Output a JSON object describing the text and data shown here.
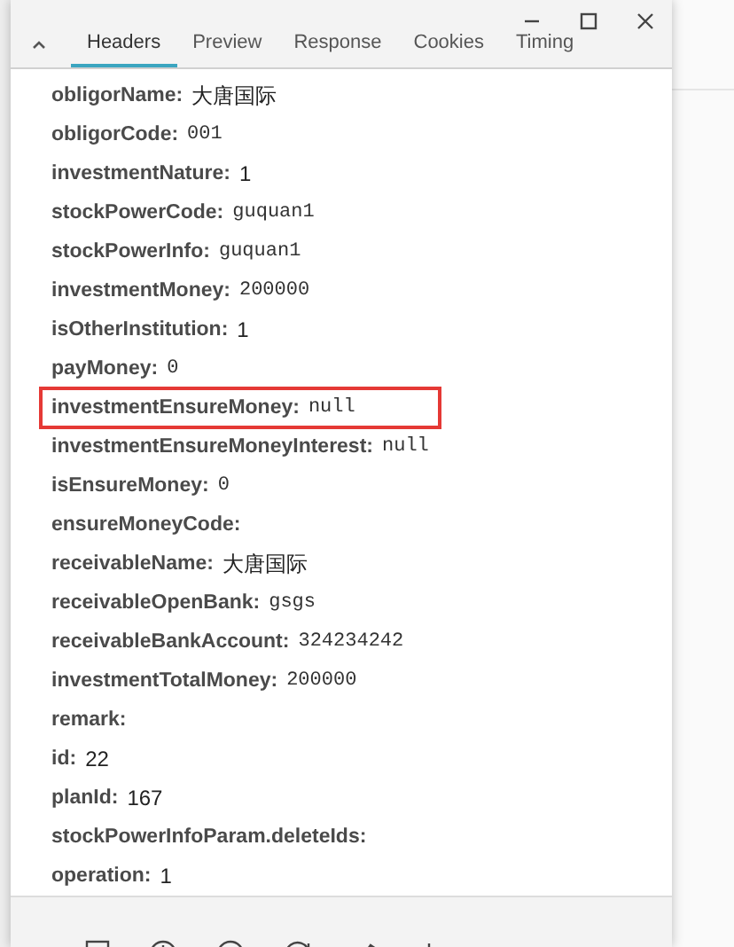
{
  "window": {
    "controls": [
      {
        "kind": "minimize"
      },
      {
        "kind": "maximize"
      },
      {
        "kind": "close"
      }
    ]
  },
  "tabs": [
    {
      "label": "Headers",
      "selected": true
    },
    {
      "label": "Preview",
      "selected": false
    },
    {
      "label": "Response",
      "selected": false
    },
    {
      "label": "Cookies",
      "selected": false
    },
    {
      "label": "Timing",
      "selected": false
    }
  ],
  "fields": [
    {
      "name": "obligorName:",
      "value": "大唐国际",
      "kind": "text",
      "highlighted": false
    },
    {
      "name": "obligorCode:",
      "value": "001",
      "kind": "mono",
      "highlighted": false
    },
    {
      "name": "investmentNature:",
      "value": "1",
      "kind": "text",
      "highlighted": false
    },
    {
      "name": "stockPowerCode:",
      "value": "guquan1",
      "kind": "mono",
      "highlighted": false
    },
    {
      "name": "stockPowerInfo:",
      "value": "guquan1",
      "kind": "mono",
      "highlighted": false
    },
    {
      "name": "investmentMoney:",
      "value": "200000",
      "kind": "mono",
      "highlighted": false
    },
    {
      "name": "isOtherInstitution:",
      "value": "1",
      "kind": "text",
      "highlighted": false
    },
    {
      "name": "payMoney:",
      "value": "0",
      "kind": "mono",
      "highlighted": false
    },
    {
      "name": "investmentEnsureMoney:",
      "value": "null",
      "kind": "mono",
      "highlighted": true
    },
    {
      "name": "investmentEnsureMoneyInterest:",
      "value": "null",
      "kind": "mono",
      "highlighted": false
    },
    {
      "name": "isEnsureMoney:",
      "value": "0",
      "kind": "mono",
      "highlighted": false
    },
    {
      "name": "ensureMoneyCode:",
      "highlighted": false
    },
    {
      "name": "receivableName:",
      "value": "大唐国际",
      "kind": "text",
      "highlighted": false
    },
    {
      "name": "receivableOpenBank:",
      "value": "gsgs",
      "kind": "mono",
      "highlighted": false
    },
    {
      "name": "receivableBankAccount:",
      "value": "324234242",
      "kind": "mono",
      "highlighted": false
    },
    {
      "name": "investmentTotalMoney:",
      "value": "200000",
      "kind": "mono",
      "highlighted": false
    },
    {
      "name": "remark:",
      "highlighted": false
    },
    {
      "name": "id:",
      "value": "22",
      "kind": "text",
      "highlighted": false
    },
    {
      "name": "planId:",
      "value": "167",
      "kind": "text",
      "highlighted": false
    },
    {
      "name": "stockPowerInfoParam.deleteIds:",
      "highlighted": false
    },
    {
      "name": "operation:",
      "value": "1",
      "kind": "text",
      "highlighted": false
    }
  ],
  "toolbar": [
    {
      "kind": "square"
    },
    {
      "kind": "info"
    },
    {
      "kind": "circle"
    },
    {
      "kind": "refresh"
    },
    {
      "kind": "pencil"
    },
    {
      "kind": "plus"
    }
  ]
}
